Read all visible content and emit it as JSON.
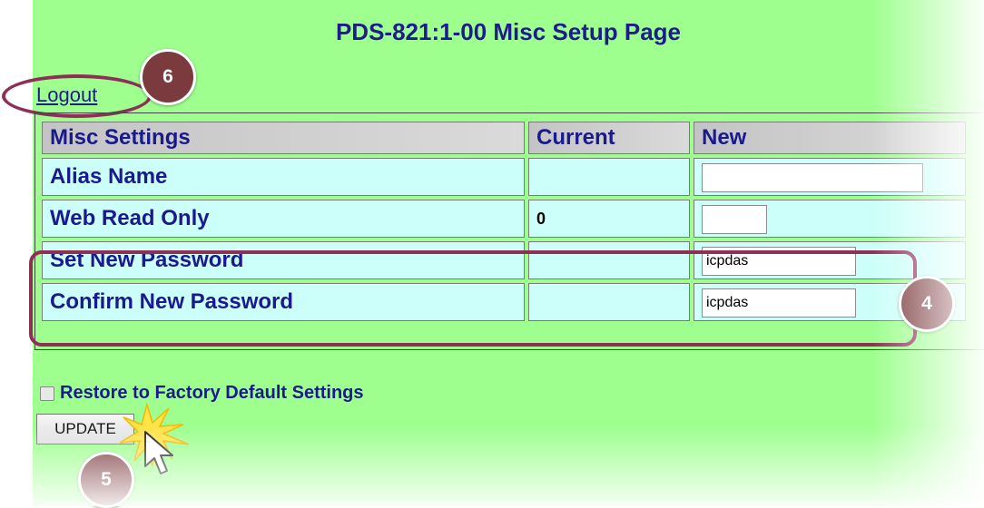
{
  "page": {
    "title": "PDS-821:1-00 Misc Setup Page"
  },
  "nav": {
    "logout_label": "Logout"
  },
  "table": {
    "headers": {
      "setting": "Misc Settings",
      "current": "Current",
      "new": "New"
    },
    "rows": [
      {
        "label": "Alias Name",
        "current": "",
        "new_value": ""
      },
      {
        "label": "Web Read Only",
        "current": "0",
        "new_value": ""
      },
      {
        "label": "Set New Password",
        "current": "",
        "new_value": "icpdas"
      },
      {
        "label": "Confirm New Password",
        "current": "",
        "new_value": "icpdas"
      }
    ]
  },
  "restore": {
    "label": "Restore to Factory Default Settings",
    "checked": false
  },
  "buttons": {
    "update_label": "UPDATE"
  },
  "annotations": {
    "badge_4": "4",
    "badge_5": "5",
    "badge_6": "6"
  },
  "colors": {
    "background": "#9eff8f",
    "cell": "#ccfff9",
    "text": "#1a1a8e",
    "highlight": "#8e2f56",
    "badge": "#7a3a3e"
  },
  "icons": {
    "cursor": "arrow-cursor-icon",
    "click": "click-burst-icon"
  }
}
